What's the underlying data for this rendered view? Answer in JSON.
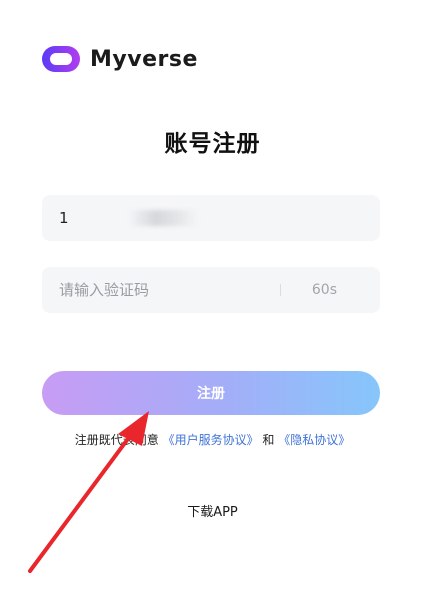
{
  "brand": {
    "name": "Myverse",
    "colors": {
      "logo_start": "#5b3cf5",
      "logo_end": "#b23cf0"
    }
  },
  "page": {
    "title": "账号注册"
  },
  "form": {
    "phone_value": "1",
    "code_placeholder": "请输入验证码",
    "countdown_label": "60s",
    "submit_label": "注册"
  },
  "agreement": {
    "prefix": "注册既代表同意",
    "user_agreement": "《用户服务协议》",
    "conjunction": "和",
    "privacy_policy": "《隐私协议》"
  },
  "footer": {
    "download_label": "下载APP"
  },
  "annotation": {
    "arrow_color": "#e8262b"
  }
}
